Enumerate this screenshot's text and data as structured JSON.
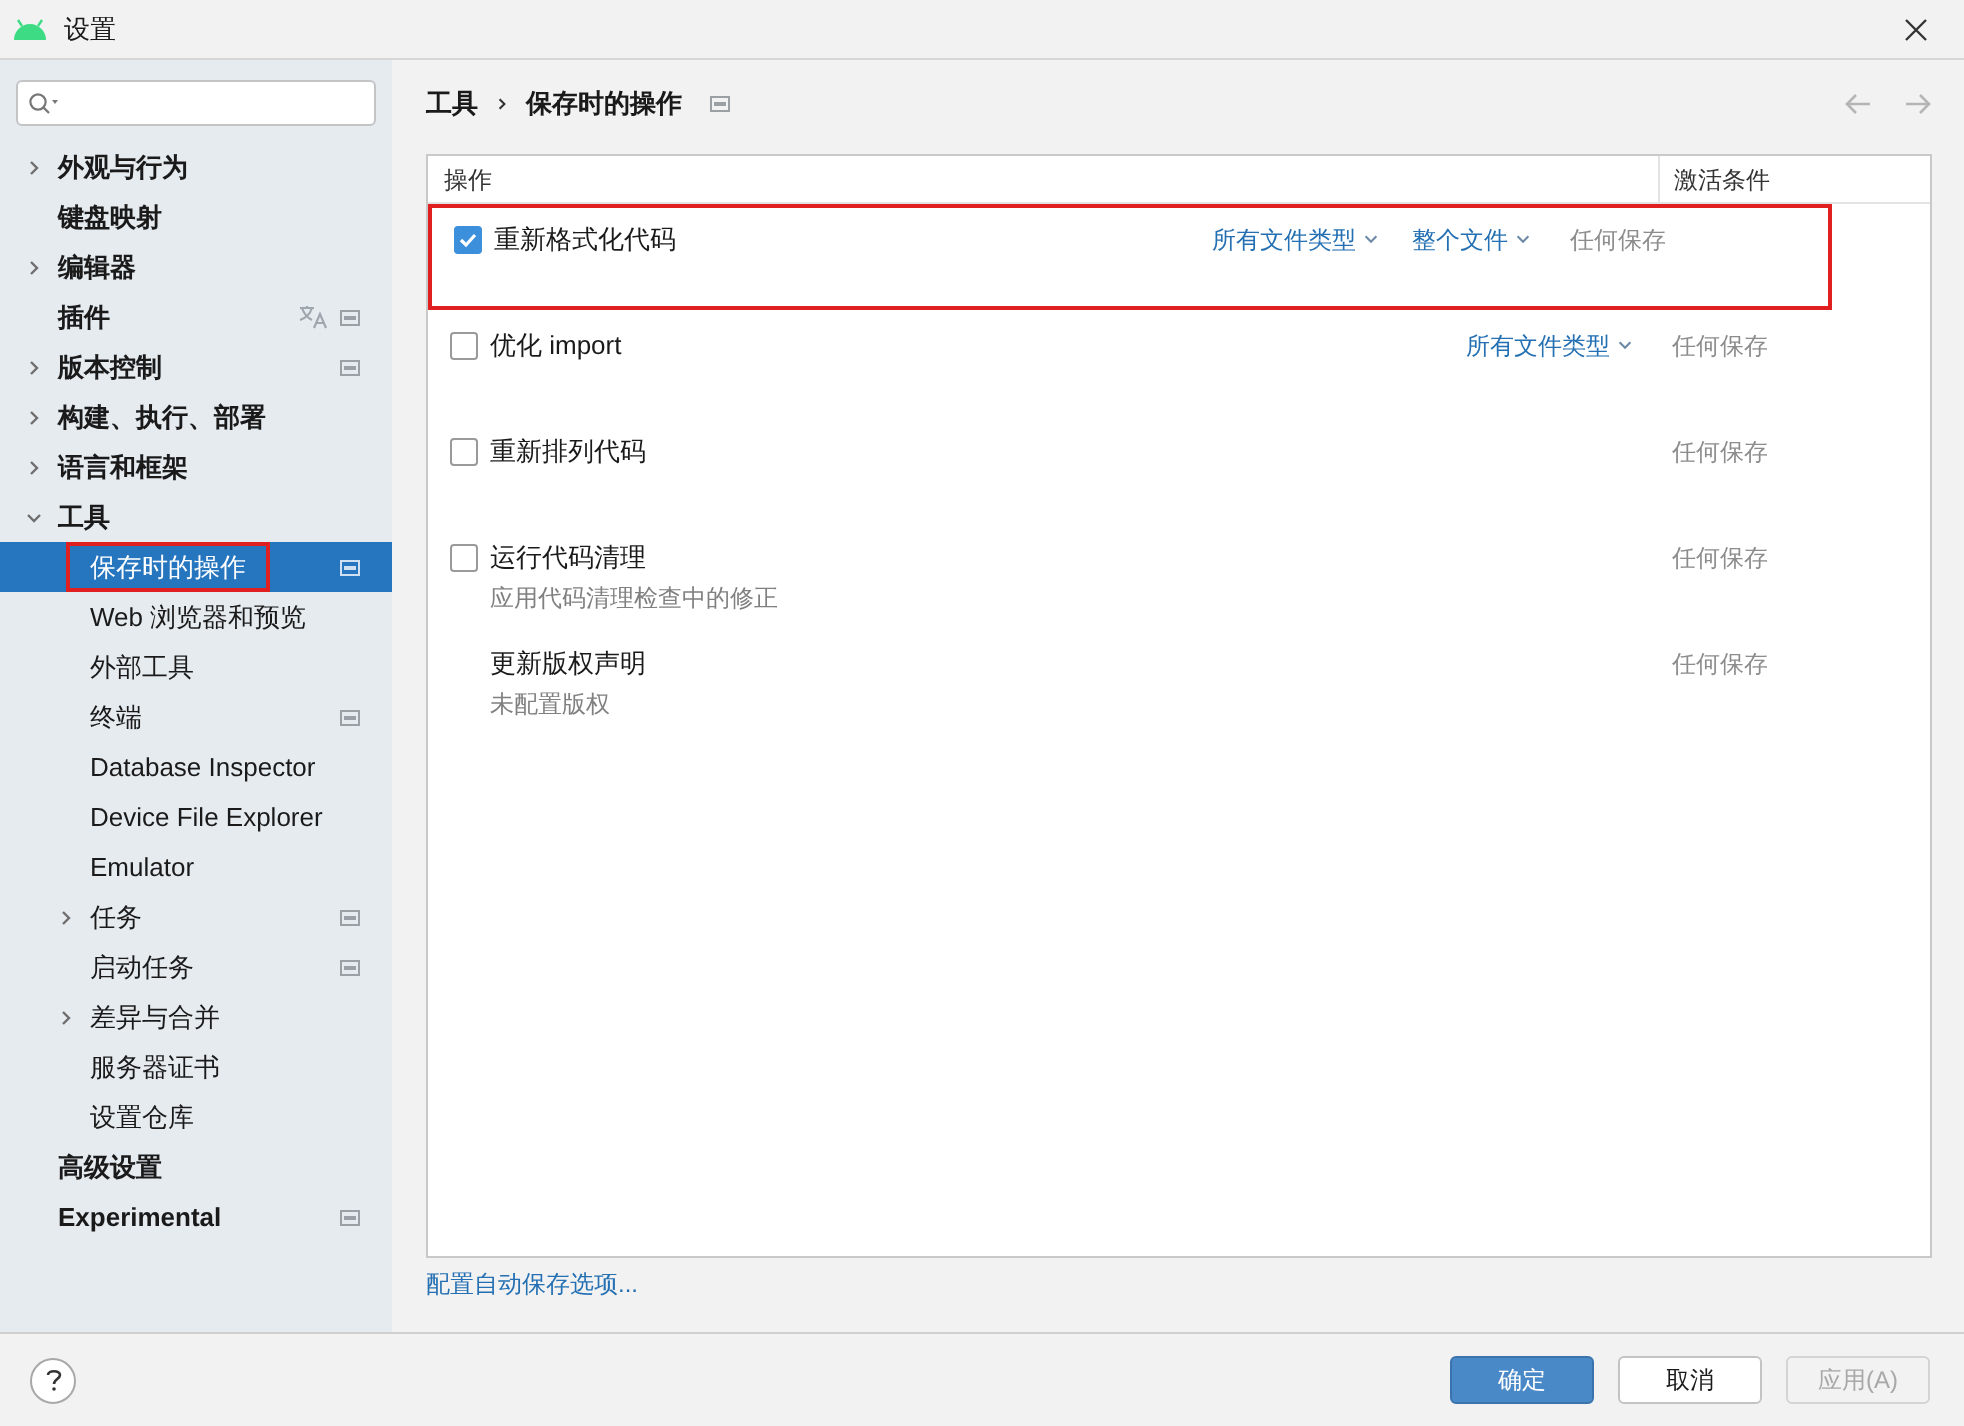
{
  "window": {
    "title": "设置"
  },
  "sidebar": {
    "items": [
      {
        "label": "外观与行为",
        "expanded": false,
        "selected": false
      },
      {
        "label": "键盘映射",
        "selected": false
      },
      {
        "label": "编辑器",
        "expanded": false,
        "selected": false
      },
      {
        "label": "插件",
        "selected": false,
        "translate_icon": true,
        "project_icon": true
      },
      {
        "label": "版本控制",
        "expanded": false,
        "selected": false,
        "project_icon": true
      },
      {
        "label": "构建、执行、部署",
        "expanded": false,
        "selected": false
      },
      {
        "label": "语言和框架",
        "expanded": false,
        "selected": false
      },
      {
        "label": "工具",
        "expanded": true,
        "selected": false,
        "children": [
          {
            "label": "保存时的操作",
            "selected": true,
            "project_icon": true,
            "highlighted": true
          },
          {
            "label": "Web 浏览器和预览",
            "selected": false
          },
          {
            "label": "外部工具",
            "selected": false
          },
          {
            "label": "终端",
            "selected": false,
            "project_icon": true
          },
          {
            "label": "Database Inspector",
            "selected": false
          },
          {
            "label": "Device File Explorer",
            "selected": false
          },
          {
            "label": "Emulator",
            "selected": false
          },
          {
            "label": "任务",
            "expanded": false,
            "selected": false,
            "project_icon": true
          },
          {
            "label": "启动任务",
            "selected": false,
            "project_icon": true
          },
          {
            "label": "差异与合并",
            "expanded": false,
            "selected": false
          },
          {
            "label": "服务器证书",
            "selected": false
          },
          {
            "label": "设置仓库",
            "selected": false
          }
        ]
      },
      {
        "label": "高级设置",
        "selected": false
      },
      {
        "label": "Experimental",
        "selected": false,
        "project_icon": true
      }
    ]
  },
  "breadcrumb": {
    "items": [
      "工具",
      "保存时的操作"
    ],
    "project_icon": true
  },
  "table": {
    "columns": [
      "操作",
      "激活条件"
    ],
    "rows": [
      {
        "kind": "checkbox",
        "checked": true,
        "label": "重新格式化代码",
        "dropdowns": [
          "所有文件类型",
          "整个文件"
        ],
        "condition": "任何保存",
        "highlighted": true
      },
      {
        "kind": "checkbox",
        "checked": false,
        "label": "优化 import",
        "dropdowns": [
          "所有文件类型"
        ],
        "condition": "任何保存"
      },
      {
        "kind": "checkbox",
        "checked": false,
        "label": "重新排列代码",
        "condition": "任何保存"
      },
      {
        "kind": "checkbox",
        "checked": false,
        "label": "运行代码清理",
        "subtitle": "应用代码清理检查中的修正",
        "condition": "任何保存"
      },
      {
        "kind": "plain",
        "label": "更新版权声明",
        "subtitle": "未配置版权",
        "condition": "任何保存"
      }
    ]
  },
  "link": "配置自动保存选项...",
  "buttons": [
    {
      "label": "确定",
      "kind": "primary",
      "disabled": false
    },
    {
      "label": "取消",
      "kind": "normal",
      "disabled": false
    },
    {
      "label": "应用(A)",
      "kind": "normal",
      "disabled": true
    }
  ]
}
